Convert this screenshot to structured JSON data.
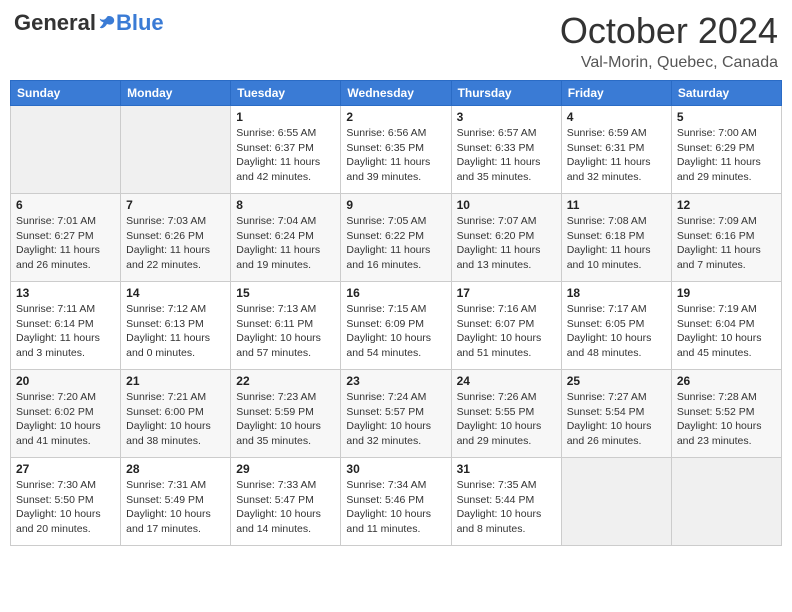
{
  "header": {
    "logo_general": "General",
    "logo_blue": "Blue",
    "month_title": "October 2024",
    "location": "Val-Morin, Quebec, Canada"
  },
  "days_of_week": [
    "Sunday",
    "Monday",
    "Tuesday",
    "Wednesday",
    "Thursday",
    "Friday",
    "Saturday"
  ],
  "weeks": [
    [
      {
        "day": "",
        "sunrise": "",
        "sunset": "",
        "daylight": "",
        "empty": true
      },
      {
        "day": "",
        "sunrise": "",
        "sunset": "",
        "daylight": "",
        "empty": true
      },
      {
        "day": "1",
        "sunrise": "Sunrise: 6:55 AM",
        "sunset": "Sunset: 6:37 PM",
        "daylight": "Daylight: 11 hours and 42 minutes.",
        "empty": false
      },
      {
        "day": "2",
        "sunrise": "Sunrise: 6:56 AM",
        "sunset": "Sunset: 6:35 PM",
        "daylight": "Daylight: 11 hours and 39 minutes.",
        "empty": false
      },
      {
        "day": "3",
        "sunrise": "Sunrise: 6:57 AM",
        "sunset": "Sunset: 6:33 PM",
        "daylight": "Daylight: 11 hours and 35 minutes.",
        "empty": false
      },
      {
        "day": "4",
        "sunrise": "Sunrise: 6:59 AM",
        "sunset": "Sunset: 6:31 PM",
        "daylight": "Daylight: 11 hours and 32 minutes.",
        "empty": false
      },
      {
        "day": "5",
        "sunrise": "Sunrise: 7:00 AM",
        "sunset": "Sunset: 6:29 PM",
        "daylight": "Daylight: 11 hours and 29 minutes.",
        "empty": false
      }
    ],
    [
      {
        "day": "6",
        "sunrise": "Sunrise: 7:01 AM",
        "sunset": "Sunset: 6:27 PM",
        "daylight": "Daylight: 11 hours and 26 minutes.",
        "empty": false
      },
      {
        "day": "7",
        "sunrise": "Sunrise: 7:03 AM",
        "sunset": "Sunset: 6:26 PM",
        "daylight": "Daylight: 11 hours and 22 minutes.",
        "empty": false
      },
      {
        "day": "8",
        "sunrise": "Sunrise: 7:04 AM",
        "sunset": "Sunset: 6:24 PM",
        "daylight": "Daylight: 11 hours and 19 minutes.",
        "empty": false
      },
      {
        "day": "9",
        "sunrise": "Sunrise: 7:05 AM",
        "sunset": "Sunset: 6:22 PM",
        "daylight": "Daylight: 11 hours and 16 minutes.",
        "empty": false
      },
      {
        "day": "10",
        "sunrise": "Sunrise: 7:07 AM",
        "sunset": "Sunset: 6:20 PM",
        "daylight": "Daylight: 11 hours and 13 minutes.",
        "empty": false
      },
      {
        "day": "11",
        "sunrise": "Sunrise: 7:08 AM",
        "sunset": "Sunset: 6:18 PM",
        "daylight": "Daylight: 11 hours and 10 minutes.",
        "empty": false
      },
      {
        "day": "12",
        "sunrise": "Sunrise: 7:09 AM",
        "sunset": "Sunset: 6:16 PM",
        "daylight": "Daylight: 11 hours and 7 minutes.",
        "empty": false
      }
    ],
    [
      {
        "day": "13",
        "sunrise": "Sunrise: 7:11 AM",
        "sunset": "Sunset: 6:14 PM",
        "daylight": "Daylight: 11 hours and 3 minutes.",
        "empty": false
      },
      {
        "day": "14",
        "sunrise": "Sunrise: 7:12 AM",
        "sunset": "Sunset: 6:13 PM",
        "daylight": "Daylight: 11 hours and 0 minutes.",
        "empty": false
      },
      {
        "day": "15",
        "sunrise": "Sunrise: 7:13 AM",
        "sunset": "Sunset: 6:11 PM",
        "daylight": "Daylight: 10 hours and 57 minutes.",
        "empty": false
      },
      {
        "day": "16",
        "sunrise": "Sunrise: 7:15 AM",
        "sunset": "Sunset: 6:09 PM",
        "daylight": "Daylight: 10 hours and 54 minutes.",
        "empty": false
      },
      {
        "day": "17",
        "sunrise": "Sunrise: 7:16 AM",
        "sunset": "Sunset: 6:07 PM",
        "daylight": "Daylight: 10 hours and 51 minutes.",
        "empty": false
      },
      {
        "day": "18",
        "sunrise": "Sunrise: 7:17 AM",
        "sunset": "Sunset: 6:05 PM",
        "daylight": "Daylight: 10 hours and 48 minutes.",
        "empty": false
      },
      {
        "day": "19",
        "sunrise": "Sunrise: 7:19 AM",
        "sunset": "Sunset: 6:04 PM",
        "daylight": "Daylight: 10 hours and 45 minutes.",
        "empty": false
      }
    ],
    [
      {
        "day": "20",
        "sunrise": "Sunrise: 7:20 AM",
        "sunset": "Sunset: 6:02 PM",
        "daylight": "Daylight: 10 hours and 41 minutes.",
        "empty": false
      },
      {
        "day": "21",
        "sunrise": "Sunrise: 7:21 AM",
        "sunset": "Sunset: 6:00 PM",
        "daylight": "Daylight: 10 hours and 38 minutes.",
        "empty": false
      },
      {
        "day": "22",
        "sunrise": "Sunrise: 7:23 AM",
        "sunset": "Sunset: 5:59 PM",
        "daylight": "Daylight: 10 hours and 35 minutes.",
        "empty": false
      },
      {
        "day": "23",
        "sunrise": "Sunrise: 7:24 AM",
        "sunset": "Sunset: 5:57 PM",
        "daylight": "Daylight: 10 hours and 32 minutes.",
        "empty": false
      },
      {
        "day": "24",
        "sunrise": "Sunrise: 7:26 AM",
        "sunset": "Sunset: 5:55 PM",
        "daylight": "Daylight: 10 hours and 29 minutes.",
        "empty": false
      },
      {
        "day": "25",
        "sunrise": "Sunrise: 7:27 AM",
        "sunset": "Sunset: 5:54 PM",
        "daylight": "Daylight: 10 hours and 26 minutes.",
        "empty": false
      },
      {
        "day": "26",
        "sunrise": "Sunrise: 7:28 AM",
        "sunset": "Sunset: 5:52 PM",
        "daylight": "Daylight: 10 hours and 23 minutes.",
        "empty": false
      }
    ],
    [
      {
        "day": "27",
        "sunrise": "Sunrise: 7:30 AM",
        "sunset": "Sunset: 5:50 PM",
        "daylight": "Daylight: 10 hours and 20 minutes.",
        "empty": false
      },
      {
        "day": "28",
        "sunrise": "Sunrise: 7:31 AM",
        "sunset": "Sunset: 5:49 PM",
        "daylight": "Daylight: 10 hours and 17 minutes.",
        "empty": false
      },
      {
        "day": "29",
        "sunrise": "Sunrise: 7:33 AM",
        "sunset": "Sunset: 5:47 PM",
        "daylight": "Daylight: 10 hours and 14 minutes.",
        "empty": false
      },
      {
        "day": "30",
        "sunrise": "Sunrise: 7:34 AM",
        "sunset": "Sunset: 5:46 PM",
        "daylight": "Daylight: 10 hours and 11 minutes.",
        "empty": false
      },
      {
        "day": "31",
        "sunrise": "Sunrise: 7:35 AM",
        "sunset": "Sunset: 5:44 PM",
        "daylight": "Daylight: 10 hours and 8 minutes.",
        "empty": false
      },
      {
        "day": "",
        "sunrise": "",
        "sunset": "",
        "daylight": "",
        "empty": true
      },
      {
        "day": "",
        "sunrise": "",
        "sunset": "",
        "daylight": "",
        "empty": true
      }
    ]
  ]
}
